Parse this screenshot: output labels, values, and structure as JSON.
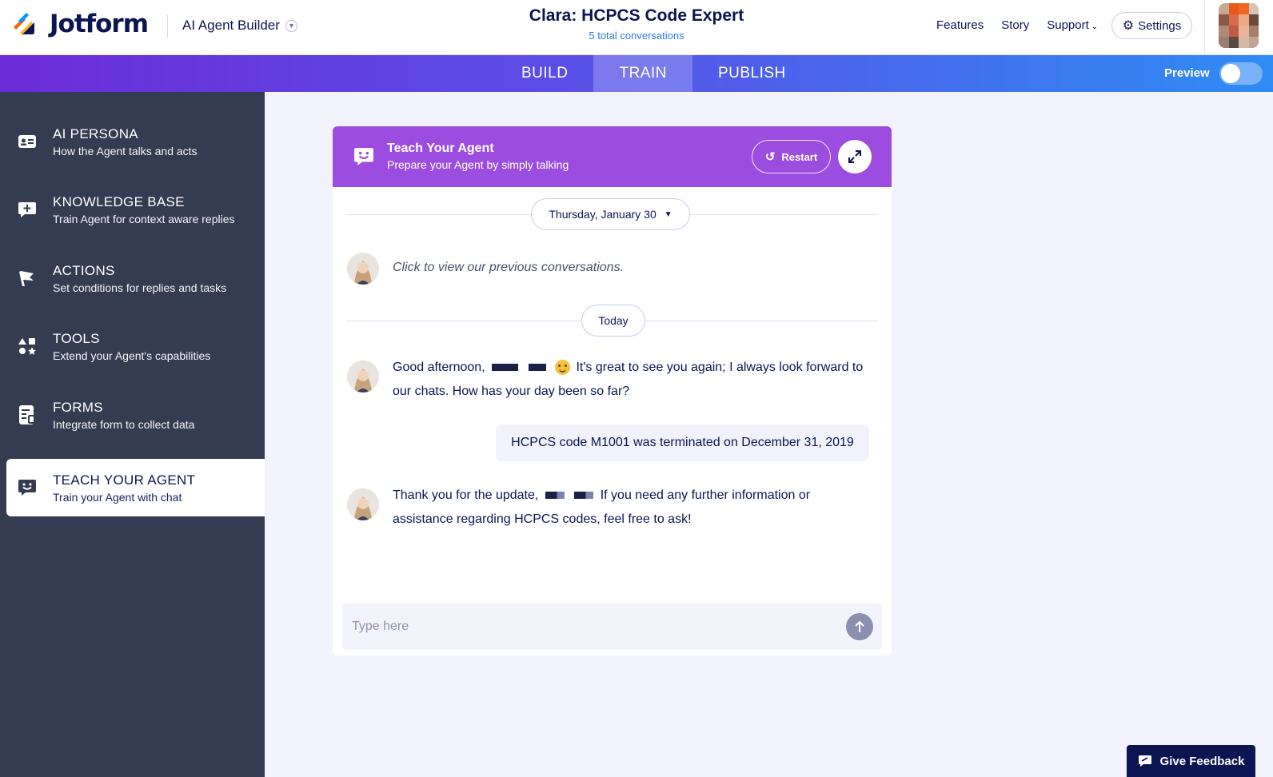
{
  "header": {
    "logo_text": "Jotform",
    "product_name": "AI Agent Builder",
    "title": "Clara: HCPCS Code Expert",
    "subtitle": "5 total conversations",
    "nav": [
      "Features",
      "Story",
      "Support"
    ],
    "settings_label": "Settings"
  },
  "tabs": {
    "items": [
      "BUILD",
      "TRAIN",
      "PUBLISH"
    ],
    "active": "TRAIN",
    "preview_label": "Preview",
    "preview_on": false
  },
  "sidebar": {
    "items": [
      {
        "title": "AI PERSONA",
        "desc": "How the Agent talks and acts",
        "icon": "id-card-icon"
      },
      {
        "title": "KNOWLEDGE BASE",
        "desc": "Train Agent for context aware replies",
        "icon": "chat-plus-icon"
      },
      {
        "title": "ACTIONS",
        "desc": "Set conditions for replies and tasks",
        "icon": "flag-icon"
      },
      {
        "title": "TOOLS",
        "desc": "Extend your Agent's capabilities",
        "icon": "shapes-icon"
      },
      {
        "title": "FORMS",
        "desc": "Integrate form to collect data",
        "icon": "form-icon"
      },
      {
        "title": "TEACH YOUR AGENT",
        "desc": "Train your Agent with chat",
        "icon": "smile-chat-icon"
      }
    ],
    "active_index": 5
  },
  "chat": {
    "title": "Teach Your Agent",
    "subtitle": "Prepare your Agent by simply talking",
    "restart_label": "Restart",
    "date_pill": "Thursday, January 30",
    "previous_link": "Click to view our previous conversations.",
    "today_pill": "Today",
    "messages": [
      {
        "from": "agent",
        "part1": "Good afternoon,",
        "part2": "It's great to see you again; I always look forward to",
        "part3": "our chats. How has your day been so far?"
      },
      {
        "from": "user",
        "text": "HCPCS code M1001 was terminated on December 31, 2019"
      },
      {
        "from": "agent",
        "part1": "Thank you for the update,",
        "part2": "If you need any further information or",
        "part3": "assistance regarding HCPCS codes, feel free to ask!"
      }
    ],
    "input_placeholder": "Type here"
  },
  "feedback_label": "Give Feedback",
  "colors": {
    "brand_navy": "#0a1551",
    "header_purple": "#9c4ddf",
    "sidebar_bg": "#343c52",
    "logo_orange": "#ff6100",
    "logo_yellow": "#ffb629",
    "logo_blue": "#0099ff"
  }
}
